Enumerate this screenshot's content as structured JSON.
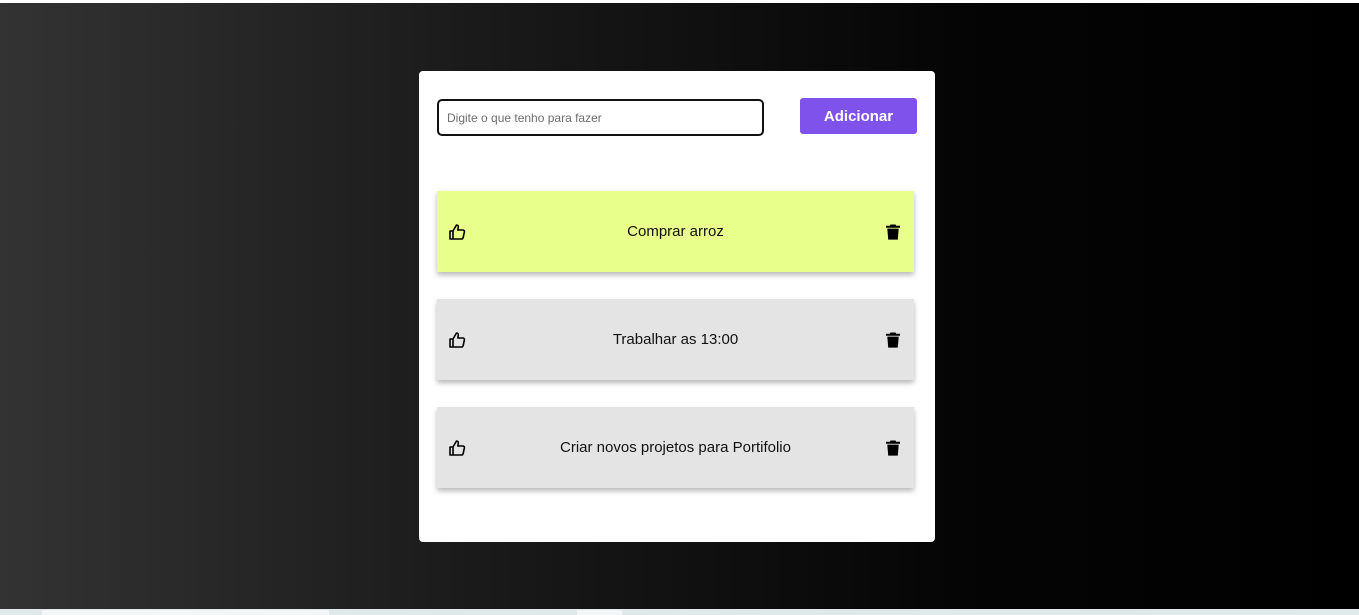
{
  "form": {
    "input_value": "",
    "input_placeholder": "Digite o que tenho para fazer",
    "add_button_label": "Adicionar"
  },
  "tasks": [
    {
      "text": "Comprar arroz",
      "done": true
    },
    {
      "text": "Trabalhar as 13:00",
      "done": false
    },
    {
      "text": "Criar novos projetos para Portifolio",
      "done": false
    }
  ],
  "icons": {
    "like": "thumbs-up-icon",
    "delete": "trash-icon"
  },
  "colors": {
    "accent": "#8052ec",
    "done_item": "#e8ff8b",
    "pending_item": "#e4e4e4"
  }
}
